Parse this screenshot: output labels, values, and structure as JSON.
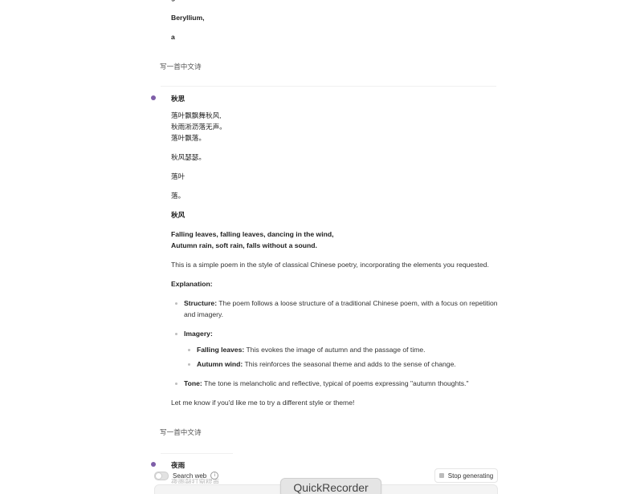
{
  "top": {
    "beryllium": "Beryllium,",
    "a": "a"
  },
  "user_msgs": {
    "first": "写一首中文诗",
    "second": "写一首中文诗"
  },
  "poem1": {
    "title": "秋思",
    "lines": [
      "落叶飘飘舞秋风,",
      "秋雨淅沥落无声。",
      "落叶飘落。"
    ],
    "line4": "秋风瑟瑟。",
    "line5": "落叶",
    "line6": "落。",
    "heading2": "秋风",
    "translation": [
      "Falling leaves, falling leaves, dancing in the wind,",
      "Autumn rain, soft rain, falls without a sound."
    ],
    "desc": "This is a simple poem in the style of classical Chinese poetry, incorporating the elements you requested.",
    "explanation_label": "Explanation:",
    "structure_label": "Structure:",
    "structure_text_1": " The poem follows a loose structure of a traditional Chinese poem, with a focus on repetition",
    "structure_text_2": "and imagery.",
    "imagery_label": "Imagery:",
    "falling_label": "Falling leaves:",
    "falling_text": " This evokes the image of autumn and the passage of time.",
    "autumn_label": "Autumn wind:",
    "autumn_text": " This reinforces the seasonal theme and adds to the sense of change.",
    "tone_label": "Tone:",
    "tone_text": " The tone is melancholic and reflective, typical of poems expressing \"autumn thoughts.\"",
    "closing": "Let me know if you'd like me to try a different style or theme!"
  },
  "poem2": {
    "title": "夜雨",
    "faded_line": "夜雨敲打窗棂声,"
  },
  "controls": {
    "search_web": "Search web",
    "info_icon": "i",
    "stop_generating": "Stop generating"
  },
  "overlay": {
    "app_name": "QuickRecorder"
  },
  "colors": {
    "accent_dot": "#7e5ea8"
  }
}
